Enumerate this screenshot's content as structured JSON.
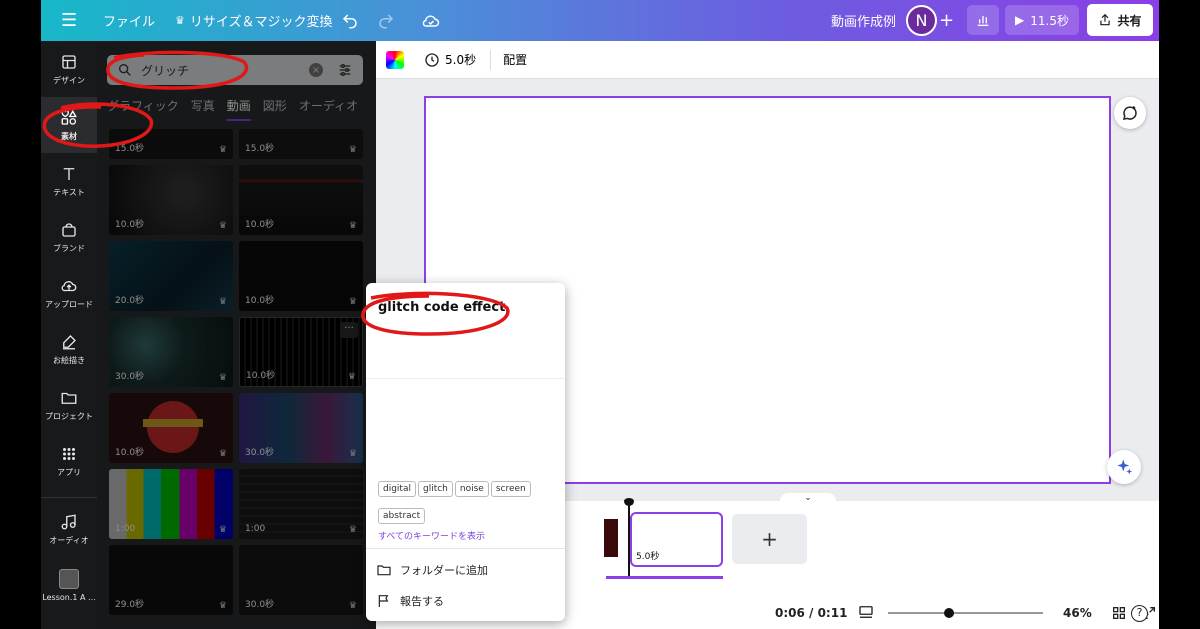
{
  "topbar": {
    "file_label": "ファイル",
    "resize_label": "リサイズ＆マジック変換",
    "project_title": "動画作成例",
    "avatar_initial": "N",
    "play_duration": "11.5秒",
    "share_label": "共有"
  },
  "rail": {
    "items": [
      {
        "label": "デザイン",
        "icon": "layout-icon"
      },
      {
        "label": "素材",
        "icon": "elements-icon"
      },
      {
        "label": "テキスト",
        "icon": "text-icon"
      },
      {
        "label": "ブランド",
        "icon": "brand-icon"
      },
      {
        "label": "アップロード",
        "icon": "upload-icon"
      },
      {
        "label": "お絵描き",
        "icon": "draw-icon"
      },
      {
        "label": "プロジェクト",
        "icon": "folder-icon"
      },
      {
        "label": "アプリ",
        "icon": "apps-icon"
      },
      {
        "label": "オーディオ",
        "icon": "music-icon"
      },
      {
        "label": "Lesson.1 A ...",
        "icon": "lesson-thumb"
      }
    ]
  },
  "panel": {
    "search_value": "グリッチ",
    "tabs": [
      "グラフィック",
      "写真",
      "動画",
      "図形",
      "オーディオ"
    ],
    "active_tab": "動画",
    "thumbs": [
      {
        "duration": "15.0秒"
      },
      {
        "duration": "15.0秒"
      },
      {
        "duration": "10.0秒"
      },
      {
        "duration": "10.0秒"
      },
      {
        "duration": "20.0秒"
      },
      {
        "duration": "10.0秒"
      },
      {
        "duration": "30.0秒"
      },
      {
        "duration": "10.0秒"
      },
      {
        "duration": "10.0秒"
      },
      {
        "duration": "30.0秒"
      },
      {
        "duration": "1:00"
      },
      {
        "duration": "1:00"
      },
      {
        "duration": "29.0秒"
      },
      {
        "duration": "30.0秒"
      }
    ]
  },
  "context_bar": {
    "duration": "5.0秒",
    "position_label": "配置"
  },
  "popup": {
    "title": "glitch code effect",
    "tags": [
      "digital",
      "glitch",
      "noise",
      "screen",
      "abstract"
    ],
    "show_keywords": "すべてのキーワードを表示",
    "add_folder": "フォルダーに追加",
    "report": "報告する"
  },
  "timeline": {
    "clip_duration": "5.0秒",
    "add_label": "+"
  },
  "bottombar": {
    "time": "0:06 / 0:11",
    "zoom": "46%",
    "help": "?"
  },
  "colors": {
    "accent": "#8b3fe6",
    "annotation_red": "#e01818"
  }
}
